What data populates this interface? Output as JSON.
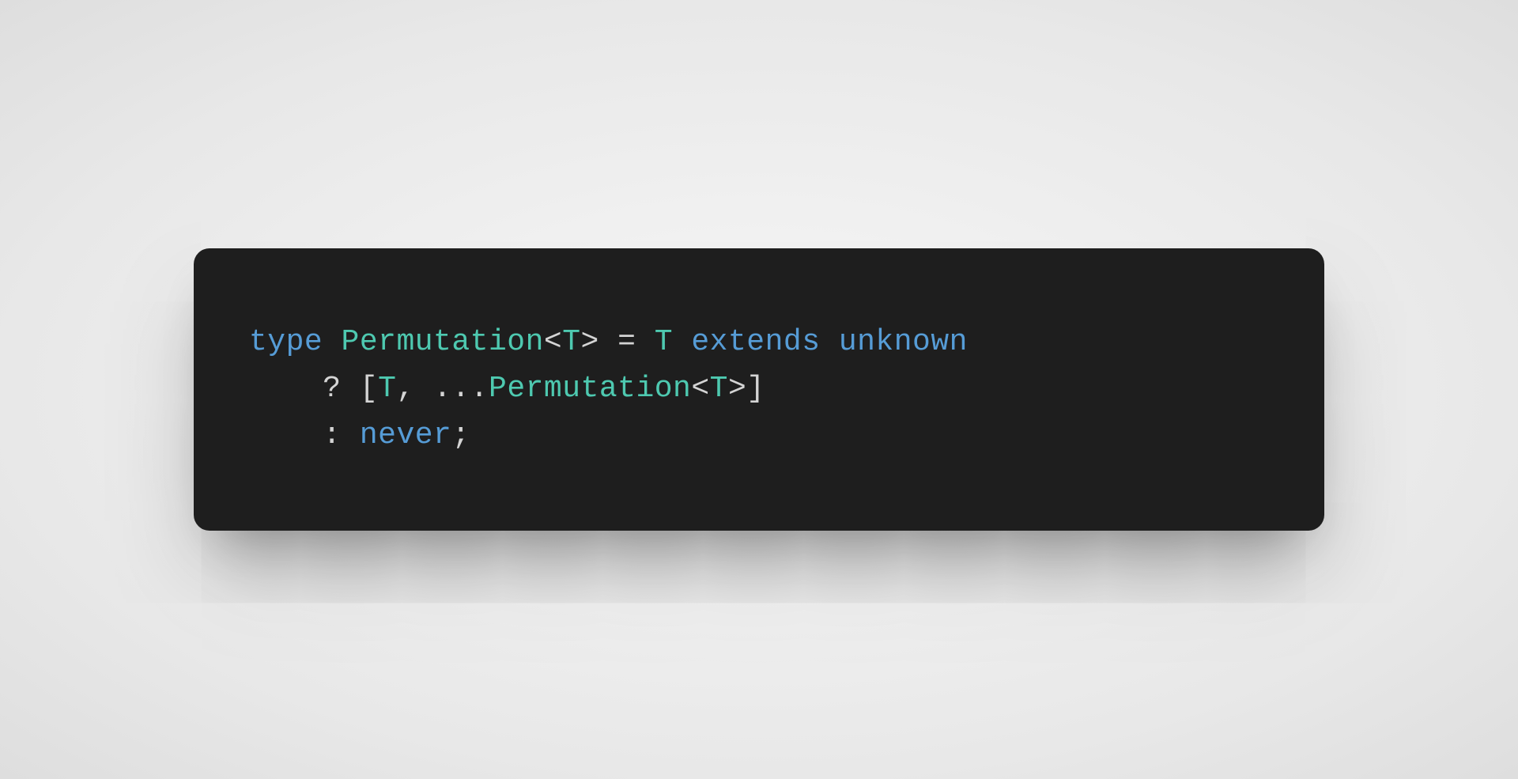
{
  "code": {
    "line1": {
      "kw_type": "type",
      "space1": " ",
      "name_permutation": "Permutation",
      "lt1": "<",
      "t1": "T",
      "gt1": ">",
      "space2": " ",
      "eq": "=",
      "space3": " ",
      "t2": "T",
      "space4": " ",
      "kw_extends": "extends",
      "space5": " ",
      "kw_unknown": "unknown"
    },
    "line2": {
      "indent": "    ",
      "qmark": "?",
      "space1": " ",
      "lbracket": "[",
      "t1": "T",
      "comma": ",",
      "space2": " ",
      "spread": "...",
      "name_permutation": "Permutation",
      "lt1": "<",
      "t2": "T",
      "gt1": ">",
      "rbracket": "]"
    },
    "line3": {
      "indent": "    ",
      "colon": ":",
      "space1": " ",
      "kw_never": "never",
      "semi": ";"
    }
  }
}
